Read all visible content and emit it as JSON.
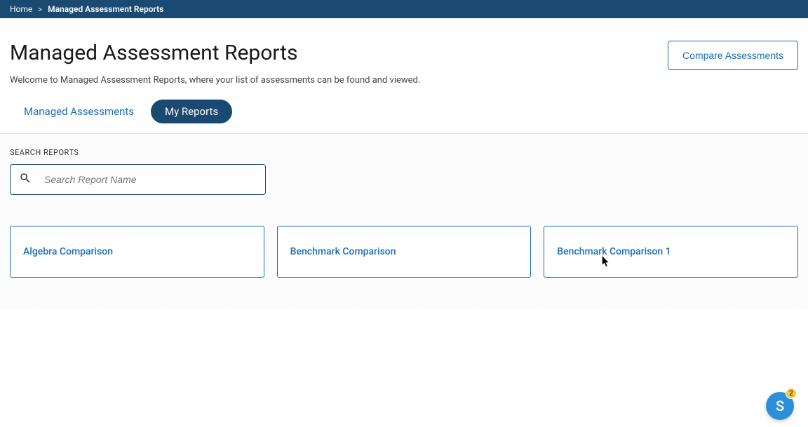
{
  "breadcrumb": {
    "home": "Home",
    "current": "Managed Assessment Reports"
  },
  "header": {
    "title": "Managed Assessment Reports",
    "subtitle": "Welcome to Managed Assessment Reports, where your list of assessments can be found and viewed.",
    "compare_button": "Compare Assessments"
  },
  "tabs": {
    "managed": "Managed Assessments",
    "my_reports": "My Reports"
  },
  "search": {
    "label": "SEARCH REPORTS",
    "placeholder": "Search Report Name"
  },
  "reports": [
    {
      "title": "Algebra Comparison"
    },
    {
      "title": "Benchmark Comparison"
    },
    {
      "title": "Benchmark Comparison 1"
    }
  ],
  "fab": {
    "letter": "S",
    "badge": "2"
  }
}
